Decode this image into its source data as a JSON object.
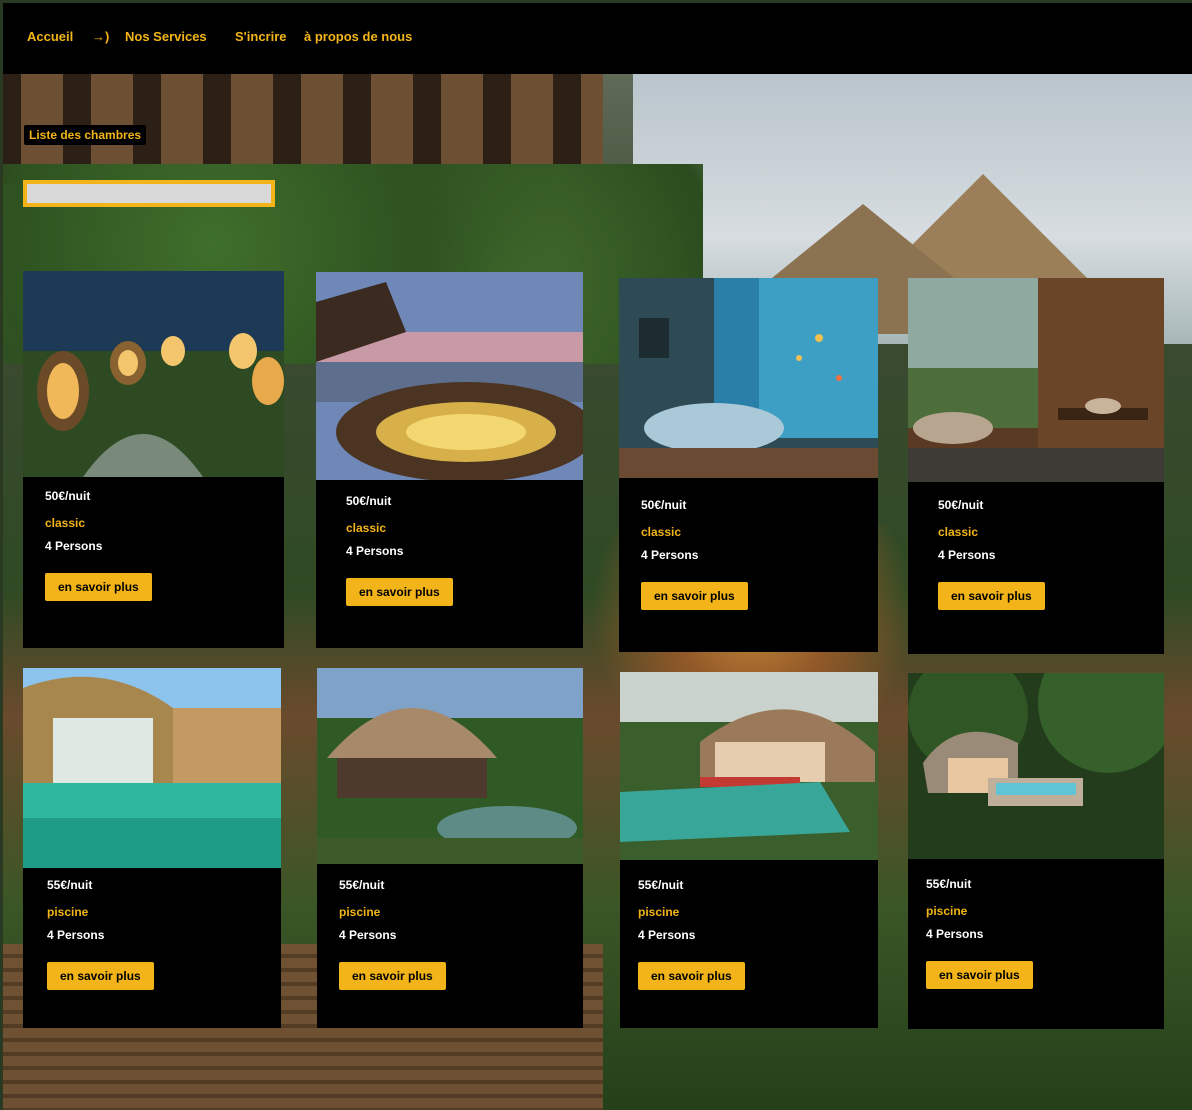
{
  "nav": {
    "home": "Accueil",
    "arrow": "→)",
    "services": "Nos Services",
    "signup": "S'incrire",
    "about": "à propos de nous"
  },
  "page": {
    "list_label": "Liste des chambres",
    "search_value": ""
  },
  "rooms": [
    {
      "price": "50€/nuit",
      "category": "classic",
      "persons": "4 Persons",
      "button": "en savoir plus",
      "image": "cabin-lanterns-forest-image"
    },
    {
      "price": "50€/nuit",
      "category": "classic",
      "persons": "4 Persons",
      "button": "en savoir plus",
      "image": "sunset-terrace-lounge-image"
    },
    {
      "price": "50€/nuit",
      "category": "classic",
      "persons": "4 Persons",
      "button": "en savoir plus",
      "image": "underwater-bedroom-image"
    },
    {
      "price": "50€/nuit",
      "category": "classic",
      "persons": "4 Persons",
      "button": "en savoir plus",
      "image": "treehouse-bathroom-image"
    },
    {
      "price": "55€/nuit",
      "category": "piscine",
      "persons": "4 Persons",
      "button": "en savoir plus",
      "image": "modern-villa-pool-image"
    },
    {
      "price": "55€/nuit",
      "category": "piscine",
      "persons": "4 Persons",
      "button": "en savoir plus",
      "image": "dome-villa-pool-image"
    },
    {
      "price": "55€/nuit",
      "category": "piscine",
      "persons": "4 Persons",
      "button": "en savoir plus",
      "image": "nest-villa-pool-image"
    },
    {
      "price": "55€/nuit",
      "category": "piscine",
      "persons": "4 Persons",
      "button": "en savoir plus",
      "image": "treetop-nest-pool-image"
    }
  ],
  "colors": {
    "accent": "#f2b418",
    "nav_bg": "#000000",
    "card_bg": "#000000"
  }
}
